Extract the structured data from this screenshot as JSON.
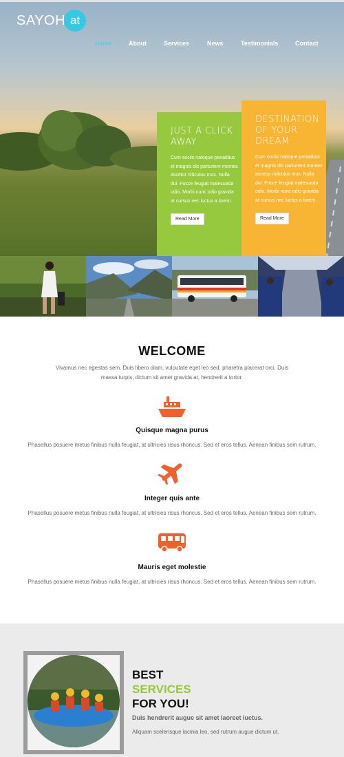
{
  "header": {
    "logo_text": "SAYOH",
    "logo_badge": "at",
    "nav": [
      "Home",
      "About",
      "Services",
      "News",
      "Testimonials",
      "Contact"
    ],
    "active_nav": "Home"
  },
  "hero": {
    "cards": [
      {
        "title": "JUST A CLICK AWAY",
        "body": "Cum sociis natoque penatibus et magnis dis parturient montes ascetur ridiculus mus. Nulla dui. Fusce feugiat malesuada odio. Morbi nunc odio gravida at cursus nec luctus a lorem.",
        "button": "Read More",
        "color": "#96c93d"
      },
      {
        "title": "DESTINATION OF YOUR DREAM",
        "body": "Cum sociis natoque penatibus et magnis dis parturient montes ascetur ridiculus mus. Nulla dui. Fusce feugiat malesuada odio. Morbi nunc odio gravida at cursus nec luctus a lorem.",
        "button": "Read More",
        "color": "#f8b433"
      }
    ]
  },
  "welcome": {
    "title": "WELCOME",
    "text": "Vivamus nec egestas sem. Duis libero diam, vulputate eget leo sed, pharetra placerat orci. Duis massa turpis, dictum sit amet gravida at, hendrerit a tortor."
  },
  "services": [
    {
      "icon": "ship-icon",
      "title": "Quisque magna purus",
      "text": "Phasellus posuere metus finibus nulla feugiat, at ultricies risus rhoncus. Sed et eros tellus. Aenean finibus sem rutrum."
    },
    {
      "icon": "plane-icon",
      "title": "Integer quis ante",
      "text": "Phasellus posuere metus finibus nulla feugiat, at ultricies risus rhoncus. Sed et eros tellus. Aenean finibus sem rutrum."
    },
    {
      "icon": "bus-icon",
      "title": "Mauris eget molestie",
      "text": "Phasellus posuere metus finibus nulla feugiat, at ultricies risus rhoncus. Sed et eros tellus. Aenean finibus sem rutrum."
    }
  ],
  "best": {
    "line1": "BEST",
    "line2": "SERVICES",
    "line3": "FOR YOU!",
    "subtitle": "Duis hendrerit augue sit amet laoreet luctus.",
    "text": "Aliquam scelerisque lacinia leo, sed rutrum augue dictum ut."
  },
  "colors": {
    "accent_blue": "#36c9e6",
    "green": "#96c93d",
    "orange": "#f8b433",
    "icon_orange": "#f0622d"
  }
}
